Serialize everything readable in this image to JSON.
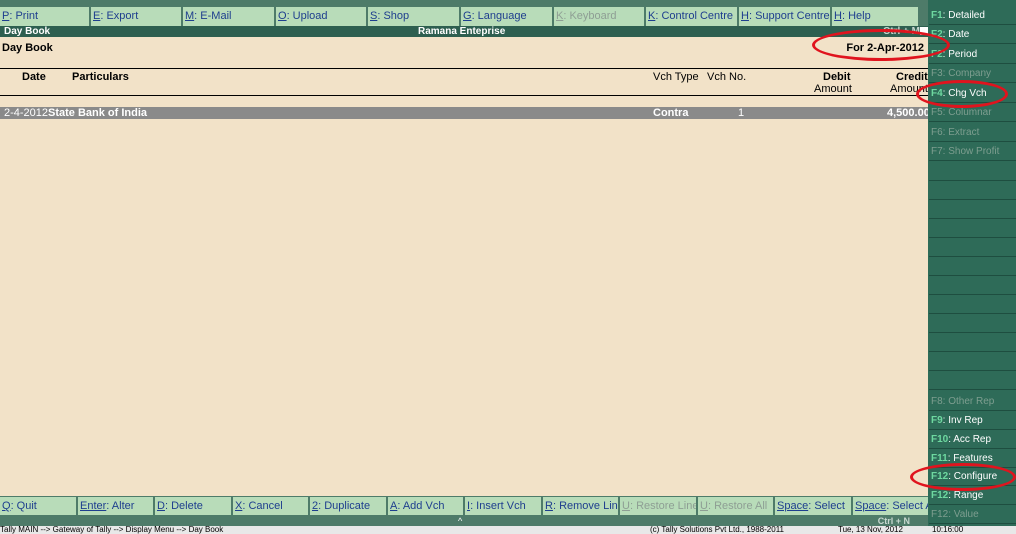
{
  "top_menu": [
    {
      "key": "P",
      "label": ": Print",
      "disabled": false
    },
    {
      "key": "E",
      "label": ": Export",
      "disabled": false
    },
    {
      "key": "M",
      "label": ": E-Mail",
      "disabled": false
    },
    {
      "key": "O",
      "label": ": Upload",
      "disabled": false
    },
    {
      "key": "S",
      "label": ": Shop",
      "disabled": false
    },
    {
      "key": "G",
      "label": ": Language",
      "disabled": false
    },
    {
      "key": "K",
      "label": ": Keyboard",
      "disabled": true
    },
    {
      "key": "K",
      "label": ": Control Centre",
      "disabled": false
    },
    {
      "key": "H",
      "label": ": Support Centre",
      "disabled": false
    },
    {
      "key": "H",
      "label": ": Help",
      "disabled": false
    }
  ],
  "title_bar": {
    "left": "Day Book",
    "center": "Ramana Enteprise",
    "right": "Ctrl + M"
  },
  "report": {
    "title": "Day Book",
    "period": "For 2-Apr-2012"
  },
  "columns": {
    "date": "Date",
    "particulars": "Particulars",
    "vch_type": "Vch Type",
    "vch_no": "Vch No.",
    "debit": "Debit",
    "debit_sub": "Amount",
    "credit": "Credit",
    "credit_sub": "Amount"
  },
  "rows": [
    {
      "date": "2-4-2012",
      "particulars": "State Bank of India",
      "vch_type": "Contra",
      "vch_no": "1",
      "debit": "",
      "credit": "4,500.00"
    }
  ],
  "sidebar": [
    {
      "key": "F1",
      "label": ": Detailed",
      "disabled": false
    },
    {
      "key": "F2",
      "label": ": Date",
      "disabled": false
    },
    {
      "key": "F2",
      "label": ": Period",
      "disabled": false
    },
    {
      "key": "F3",
      "label": ": Company",
      "disabled": true
    },
    {
      "key": "F4",
      "label": ": Chg Vch",
      "disabled": false
    },
    {
      "key": "F5",
      "label": ": Columnar",
      "disabled": true
    },
    {
      "key": "F6",
      "label": ": Extract",
      "disabled": true
    },
    {
      "key": "F7",
      "label": ": Show Profit",
      "disabled": true
    },
    {
      "key": "F8",
      "label": ": Other Rep",
      "disabled": true
    },
    {
      "key": "F9",
      "label": ": Inv Rep",
      "disabled": false
    },
    {
      "key": "F10",
      "label": ": Acc Rep",
      "disabled": false
    },
    {
      "key": "F11",
      "label": ": Features",
      "disabled": false
    },
    {
      "key": "F12",
      "label": ": Configure",
      "disabled": false
    },
    {
      "key": "F12",
      "label": ": Range",
      "disabled": false
    },
    {
      "key": "F12",
      "label": ": Value",
      "disabled": true
    }
  ],
  "bottom_menu": [
    {
      "key": "Q",
      "label": ": Quit",
      "disabled": false
    },
    {
      "key": "Enter",
      "label": ": Alter",
      "disabled": false
    },
    {
      "key": "D",
      "label": ": Delete",
      "disabled": false
    },
    {
      "key": "X",
      "label": ": Cancel",
      "disabled": false
    },
    {
      "key": "2",
      "label": ": Duplicate",
      "disabled": false
    },
    {
      "key": "A",
      "label": ": Add Vch",
      "disabled": false
    },
    {
      "key": "I",
      "label": ": Insert Vch",
      "disabled": false
    },
    {
      "key": "R",
      "label": ": Remove Line",
      "disabled": false
    },
    {
      "key": "U",
      "label": ": Restore Line",
      "disabled": true
    },
    {
      "key": "U",
      "label": ": Restore All",
      "disabled": true
    },
    {
      "key": "Space",
      "label": ": Select",
      "disabled": false
    },
    {
      "key": "Space",
      "label": ": Select All",
      "disabled": false
    }
  ],
  "bottom_strip": {
    "caret": "^",
    "hint": "Ctrl + N"
  },
  "status_bar": {
    "path": "Tally MAIN --> Gateway of Tally --> Display Menu --> Day Book",
    "copyright": "(c) Tally Solutions Pvt Ltd., 1988-2011",
    "date": "Tue, 13 Nov, 2012",
    "time": "10:16:00"
  },
  "colors": {
    "menu_bg": "#b8dcb9",
    "bar_bg": "#4e7b69",
    "sidebar_bg": "#2e6b58",
    "content_bg": "#f2e2c8",
    "highlight_ring": "#e0141e"
  }
}
